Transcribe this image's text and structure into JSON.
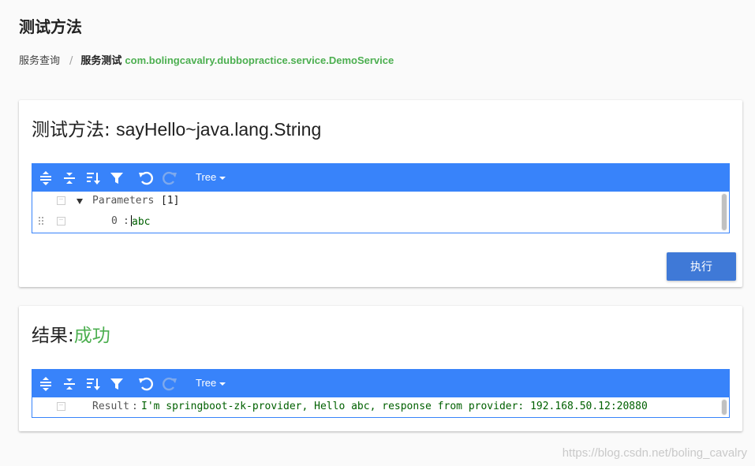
{
  "page": {
    "title": "测试方法"
  },
  "breadcrumb": {
    "root": "服务查询",
    "separator": "/",
    "current": "服务测试",
    "service": "com.bolingcavalry.dubbopractice.service.DemoService"
  },
  "method_card": {
    "title_prefix": "测试方法: ",
    "method": "sayHello~java.lang.String",
    "editor": {
      "mode_label": "Tree",
      "toolbar_icons": [
        "expand-all-icon",
        "collapse-all-icon",
        "sort-icon",
        "filter-icon",
        "undo-icon",
        "redo-icon"
      ],
      "root_field": "Parameters",
      "root_count": "[1]",
      "item_index": "0",
      "item_value": "abc"
    },
    "execute_label": "执行"
  },
  "result_card": {
    "title_prefix": "结果:",
    "status": "成功",
    "editor": {
      "mode_label": "Tree",
      "field": "Result",
      "value": "I'm springboot-zk-provider, Hello abc, response from provider: 192.168.50.12:20880"
    }
  },
  "watermark": "https://blog.csdn.net/boling_cavalry",
  "colors": {
    "accent": "#3883fa",
    "button": "#3f79d7",
    "success": "#4caf50"
  }
}
